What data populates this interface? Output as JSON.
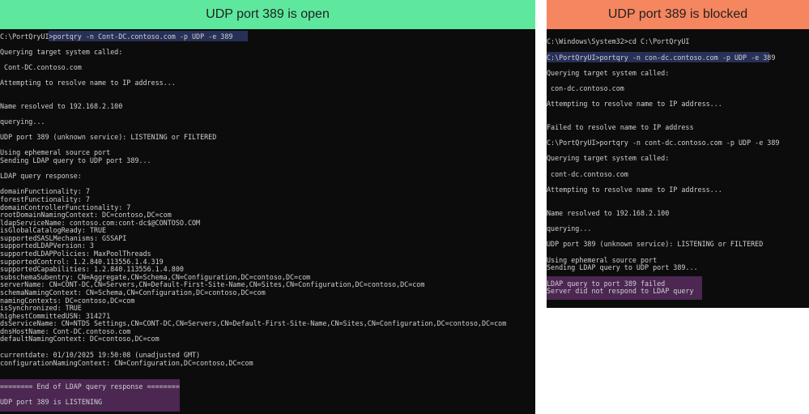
{
  "left": {
    "header": "UDP port 389 is open",
    "header_color": "#5ee89e",
    "lines": [
      "C:\\PortQryUI>portqry -n Cont-DC.contoso.com -p UDP -e 389",
      "Querying target system called:",
      " Cont-DC.contoso.com",
      "Attempting to resolve name to IP address...",
      "Name resolved to 192.168.2.100",
      "querying...",
      "UDP port 389 (unknown service): LISTENING or FILTERED",
      "Using ephemeral source port",
      "Sending LDAP query to UDP port 389...",
      "LDAP query response:",
      "domainFunctionality: 7",
      "forestFunctionality: 7",
      "domainControllerFunctionality: 7",
      "rootDomainNamingContext: DC=contoso,DC=com",
      "ldapServiceName: contoso.com:cont-dc$@CONTOSO.COM",
      "isGlobalCatalogReady: TRUE",
      "supportedSASLMechanisms: GSSAPI",
      "supportedLDAPVersion: 3",
      "supportedLDAPPolicies: MaxPoolThreads",
      "supportedControl: 1.2.840.113556.1.4.319",
      "supportedCapabilities: 1.2.840.113556.1.4.800",
      "subschemaSubentry: CN=Aggregate,CN=Schema,CN=Configuration,DC=contoso,DC=com",
      "serverName: CN=CONT-DC,CN=Servers,CN=Default-First-Site-Name,CN=Sites,CN=Configuration,DC=contoso,DC=com",
      "schemaNamingContext: CN=Schema,CN=Configuration,DC=contoso,DC=com",
      "namingContexts: DC=contoso,DC=com",
      "isSynchronized: TRUE",
      "highestCommittedUSN: 314271",
      "dsServiceName: CN=NTDS Settings,CN=CONT-DC,CN=Servers,CN=Default-First-Site-Name,CN=Sites,CN=Configuration,DC=contoso,DC=com",
      "dnsHostName: Cont-DC.contoso.com",
      "defaultNamingContext: DC=contoso,DC=com",
      "currentdate: 01/10/2025 19:50:08 (unadjusted GMT)",
      "configurationNamingContext: CN=Configuration,DC=contoso,DC=com",
      "======== End of LDAP query response ========",
      "UDP port 389 is LISTENING"
    ]
  },
  "right": {
    "header": "UDP port 389 is blocked",
    "header_color": "#f6865f",
    "lines": [
      "C:\\Windows\\System32>cd C:\\PortQryUI",
      "C:\\PortQryUI>portqry -n con-dc.contoso.com -p UDP -e 389",
      "Querying target system called:",
      " con-dc.contoso.com",
      "Attempting to resolve name to IP address...",
      "Failed to resolve name to IP address",
      "C:\\PortQryUI>portqry -n cont-dc.contoso.com -p UDP -e 389",
      "Querying target system called:",
      " cont-dc.contoso.com",
      "Attempting to resolve name to IP address...",
      "Name resolved to 192.168.2.100",
      "querying...",
      "UDP port 389 (unknown service): LISTENING or FILTERED",
      "Using ephemeral source port",
      "Sending LDAP query to UDP port 389...",
      "LDAP query to port 389 failed",
      "Server did not respond to LDAP query"
    ]
  }
}
